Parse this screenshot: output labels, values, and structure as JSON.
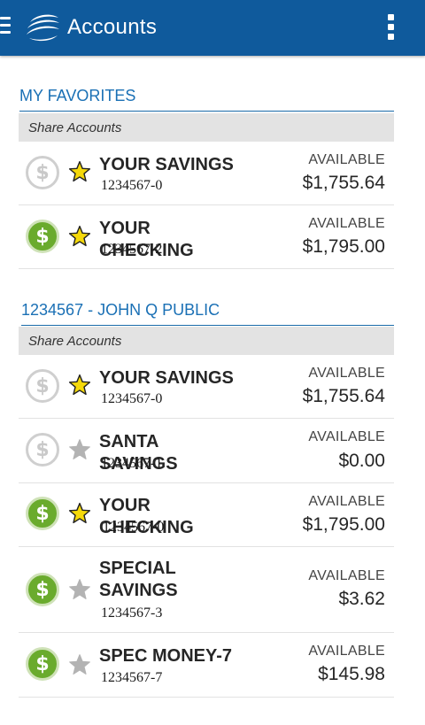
{
  "appbar": {
    "title": "Accounts",
    "menu_icon": "hamburger-menu-icon",
    "logo_icon": "credit-union-logo-icon",
    "overflow_icon": "overflow-menu-icon",
    "color": "#0f5a9c"
  },
  "favorites": {
    "title": "MY FAVORITES",
    "group_label": "Share Accounts",
    "accounts": [
      {
        "name": "YOUR SAVINGS",
        "number": "1234567-0",
        "label": "AVAILABLE",
        "amount": "$1,755.64",
        "active": false,
        "favorite": true
      },
      {
        "name": "YOUR CHECKING",
        "number": "1234567-2",
        "label": "AVAILABLE",
        "amount": "$1,795.00",
        "active": true,
        "favorite": true
      }
    ]
  },
  "member": {
    "title": "1234567 - JOHN Q PUBLIC",
    "group_label": "Share Accounts",
    "accounts": [
      {
        "name": "YOUR SAVINGS",
        "number": "1234567-0",
        "label": "AVAILABLE",
        "amount": "$1,755.64",
        "active": false,
        "favorite": true
      },
      {
        "name": "SANTA SAVINGS",
        "number": "1234567-1",
        "label": "AVAILABLE",
        "amount": "$0.00",
        "active": false,
        "favorite": false
      },
      {
        "name": "YOUR CHECKING",
        "number": "1234567-0",
        "label": "AVAILABLE",
        "amount": "$1,795.00",
        "active": true,
        "favorite": true
      },
      {
        "name": "SPECIAL SAVINGS",
        "number": "1234567-3",
        "label": "AVAILABLE",
        "amount": "$3.62",
        "active": true,
        "favorite": false
      },
      {
        "name": "SPEC MONEY-7",
        "number": "1234567-7",
        "label": "AVAILABLE",
        "amount": "$145.98",
        "active": true,
        "favorite": false
      }
    ]
  },
  "icons": {
    "dollar": "$",
    "star_filled_color": "#f5d90a",
    "star_outline_color": "#222222",
    "star_empty_color": "#b3b3b3",
    "dollar_active_color": "#6aab2d",
    "dollar_inactive_color": "#c9c9c9"
  }
}
